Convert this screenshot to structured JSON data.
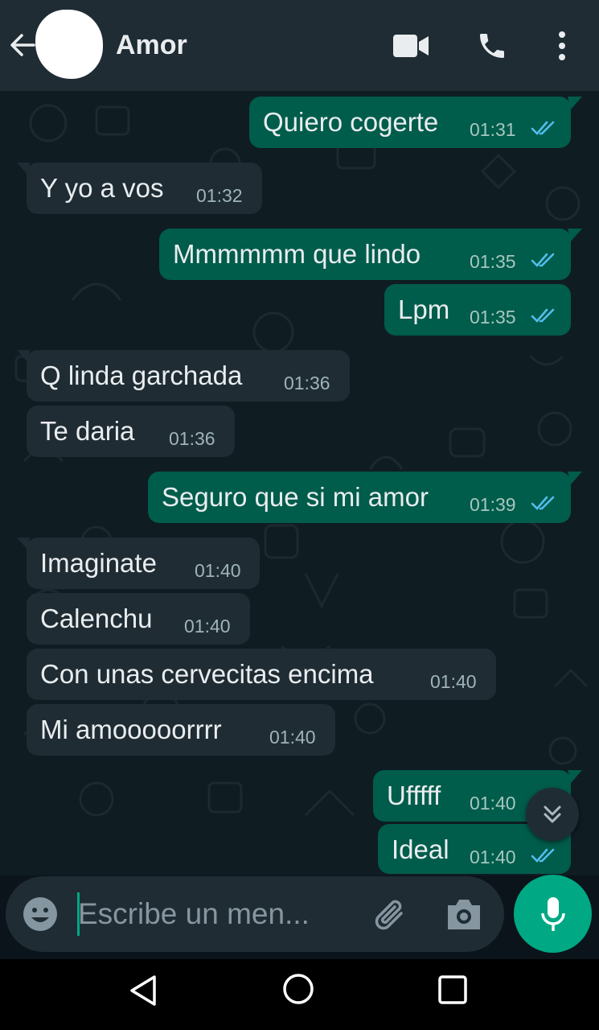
{
  "header": {
    "contact_name": "Amor",
    "icons": [
      "back-arrow-icon",
      "avatar",
      "video-call-icon",
      "phone-icon",
      "more-vert-icon"
    ]
  },
  "messages": [
    {
      "direction": "out",
      "text": "Quiero cogerte",
      "time": "01:31",
      "status": "read"
    },
    {
      "direction": "in",
      "text": "Y yo a vos",
      "time": "01:32"
    },
    {
      "direction": "out",
      "text": "Mmmmmm que lindo",
      "time": "01:35",
      "status": "read"
    },
    {
      "direction": "out",
      "text": "Lpm",
      "time": "01:35",
      "status": "read"
    },
    {
      "direction": "in",
      "text": "Q linda garchada",
      "time": "01:36"
    },
    {
      "direction": "in",
      "text": "Te daria",
      "time": "01:36"
    },
    {
      "direction": "out",
      "text": "Seguro que si mi amor",
      "time": "01:39",
      "status": "read"
    },
    {
      "direction": "in",
      "text": "Imaginate",
      "time": "01:40"
    },
    {
      "direction": "in",
      "text": "Calenchu",
      "time": "01:40"
    },
    {
      "direction": "in",
      "text": "Con unas cervecitas encima",
      "time": "01:40"
    },
    {
      "direction": "in",
      "text": "Mi amooooorrrr",
      "time": "01:40"
    },
    {
      "direction": "out",
      "text": "Ufffff",
      "time": "01:40",
      "status": "read"
    },
    {
      "direction": "out",
      "text": "Ideal",
      "time": "01:40",
      "status": "read"
    }
  ],
  "composer": {
    "placeholder": "Escribe un men...",
    "icons": [
      "emoji-icon",
      "attach-icon",
      "camera-icon",
      "mic-icon"
    ]
  },
  "colors": {
    "header_bg": "#1f2c34",
    "chat_bg": "#0f1c22",
    "incoming_bubble": "#1f2c34",
    "outgoing_bubble": "#005c4b",
    "accent": "#00a884",
    "read_ticks": "#53bdeb"
  }
}
